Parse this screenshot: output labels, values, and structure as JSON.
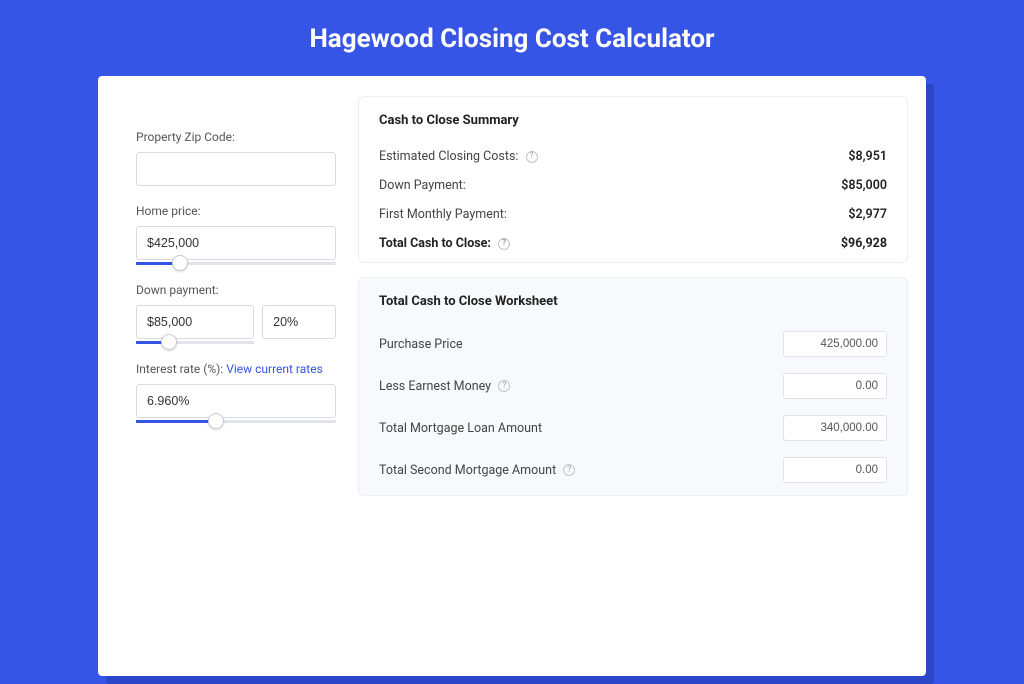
{
  "title": "Hagewood Closing Cost Calculator",
  "left": {
    "zip_label": "Property Zip Code:",
    "zip_value": "",
    "home_price_label": "Home price:",
    "home_price_value": "$425,000",
    "home_price_slider_pct": 22,
    "down_payment_label": "Down payment:",
    "down_payment_value": "$85,000",
    "down_payment_pct": "20%",
    "down_payment_slider_pct": 28,
    "rate_label_prefix": "Interest rate (%): ",
    "rate_link": "View current rates",
    "rate_value": "6.960%",
    "rate_slider_pct": 40
  },
  "summary": {
    "title": "Cash to Close Summary",
    "rows": [
      {
        "label": "Estimated Closing Costs:",
        "help": true,
        "value": "$8,951"
      },
      {
        "label": "Down Payment:",
        "help": false,
        "value": "$85,000"
      },
      {
        "label": "First Monthly Payment:",
        "help": false,
        "value": "$2,977"
      }
    ],
    "total_label": "Total Cash to Close:",
    "total_value": "$96,928"
  },
  "worksheet": {
    "title": "Total Cash to Close Worksheet",
    "rows": [
      {
        "label": "Purchase Price",
        "help": false,
        "value": "425,000.00"
      },
      {
        "label": "Less Earnest Money",
        "help": true,
        "value": "0.00"
      },
      {
        "label": "Total Mortgage Loan Amount",
        "help": false,
        "value": "340,000.00"
      },
      {
        "label": "Total Second Mortgage Amount",
        "help": true,
        "value": "0.00"
      }
    ]
  }
}
